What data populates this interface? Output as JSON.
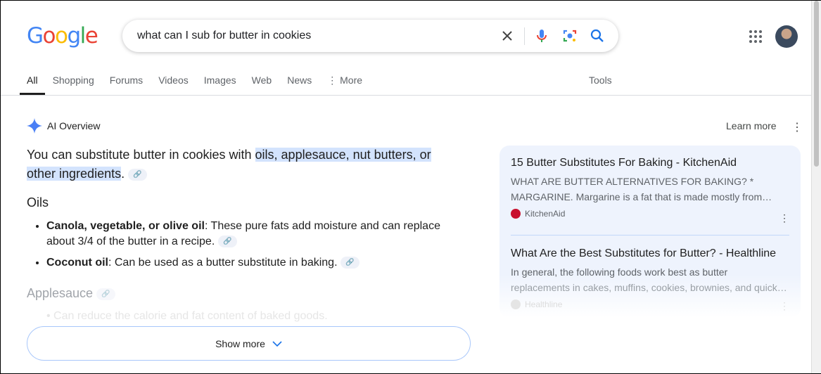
{
  "header": {
    "logo": "Google",
    "query": "what can I sub for butter in cookies"
  },
  "tabs": [
    {
      "label": "All"
    },
    {
      "label": "Shopping"
    },
    {
      "label": "Forums"
    },
    {
      "label": "Videos"
    },
    {
      "label": "Images"
    },
    {
      "label": "Web"
    },
    {
      "label": "News"
    },
    {
      "label": "More"
    }
  ],
  "tools": "Tools",
  "ai": {
    "title": "AI Overview",
    "learn_more": "Learn more",
    "intro_pre": "You can substitute butter in cookies with ",
    "intro_hl": "oils, applesauce, nut butters, or other ingredients",
    "intro_post": ".",
    "oils_heading": "Oils",
    "bullets": [
      {
        "bold": "Canola, vegetable, or olive oil",
        "text": ": These pure fats add moisture and can replace about 3/4 of the butter in a recipe."
      },
      {
        "bold": "Coconut oil",
        "text": ": Can be used as a butter substitute in baking."
      }
    ],
    "apple_heading": "Applesauce",
    "apple_bullet": "Can reduce the calorie and fat content of baked goods.",
    "show_more": "Show more"
  },
  "sources": [
    {
      "title": "15 Butter Substitutes For Baking - KitchenAid",
      "snippet1": "WHAT ARE BUTTER ALTERNATIVES FOR BAKING? *",
      "snippet2": "MARGARINE. Margarine is a fat that is made mostly from…",
      "site": "KitchenAid",
      "color": "#c8102e"
    },
    {
      "title": "What Are the Best Substitutes for Butter? - Healthline",
      "snippet1": "In general, the following foods work best as butter",
      "snippet2": "replacements in cakes, muffins, cookies, brownies, and quick…",
      "site": "Healthline",
      "color": "#d0d0d0"
    }
  ]
}
